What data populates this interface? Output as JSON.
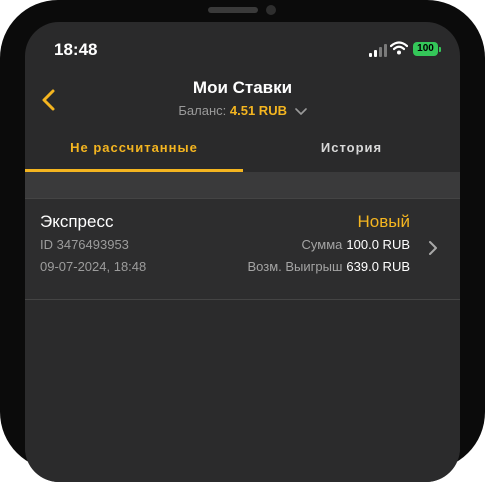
{
  "status_bar": {
    "time": "18:48",
    "battery": "100"
  },
  "header": {
    "title": "Мои Ставки",
    "balance_label": "Баланс:",
    "balance_value": "4.51 RUB"
  },
  "tabs": [
    {
      "label": "Не рассчитанные",
      "active": true
    },
    {
      "label": "История",
      "active": false
    }
  ],
  "bets": [
    {
      "type": "Экспресс",
      "id": "ID 3476493953",
      "datetime": "09-07-2024, 18:48",
      "status": "Новый",
      "amount_label": "Сумма",
      "amount_value": "100.0 RUB",
      "win_label": "Возм. Выигрыш",
      "win_value": "639.0 RUB"
    }
  ],
  "colors": {
    "accent": "#f4b520",
    "screen_bg": "#2a2a2b",
    "battery": "#34c759"
  },
  "icons": [
    "back-chevron-icon",
    "dropdown-chevron-icon",
    "chevron-right-icon",
    "signal-icon",
    "wifi-icon",
    "battery-icon"
  ]
}
